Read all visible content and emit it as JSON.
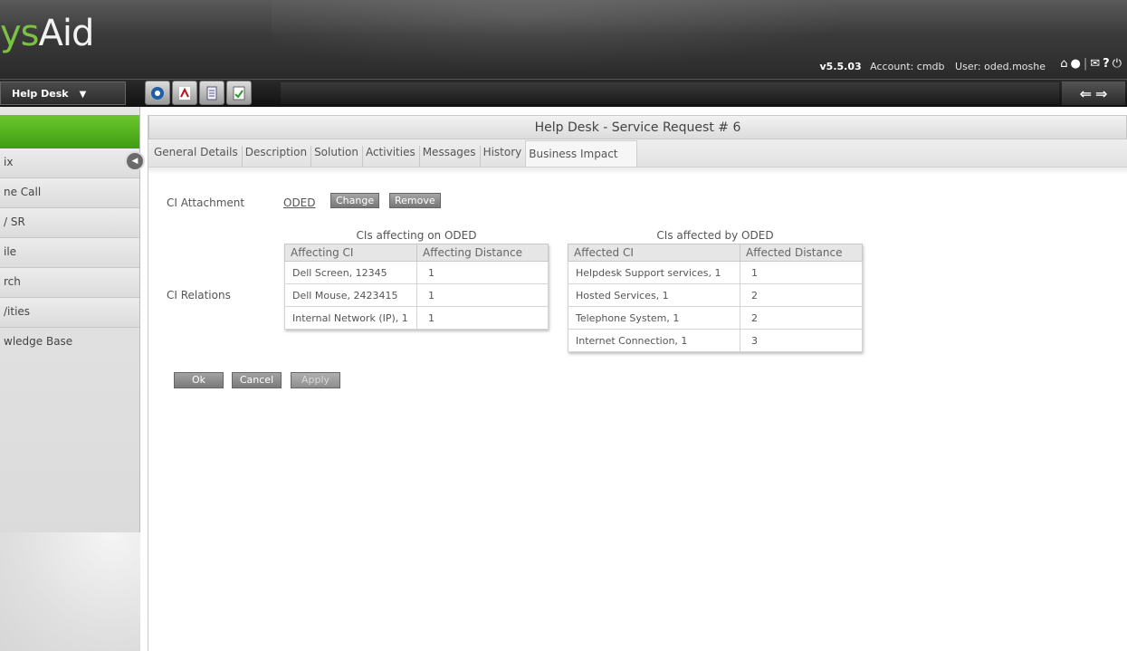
{
  "header": {
    "logo_prefix": "ys",
    "logo_suffix": "Aid",
    "version": "v5.5.03",
    "account_text": "Account: cmdb",
    "user_text": "User: oded.moshe",
    "icons": [
      "home-icon",
      "user-icon",
      "mail-icon",
      "help-icon",
      "power-icon"
    ]
  },
  "toolbar": {
    "module_label": "Help Desk",
    "tools": [
      "settings-icon",
      "pdf-icon",
      "print-icon",
      "spellcheck-icon"
    ],
    "nav": [
      "back-arrow-icon",
      "forward-arrow-icon"
    ]
  },
  "sidebar": {
    "items": [
      {
        "label": "ix"
      },
      {
        "label": "ne Call"
      },
      {
        "label": "/ SR"
      },
      {
        "label": "ile"
      },
      {
        "label": "rch"
      },
      {
        "label": "/ities"
      },
      {
        "label": "wledge Base"
      }
    ]
  },
  "main": {
    "title": "Help Desk - Service Request # 6",
    "tabs": [
      {
        "label": "General Details"
      },
      {
        "label": "Description"
      },
      {
        "label": "Solution"
      },
      {
        "label": "Activities"
      },
      {
        "label": "Messages"
      },
      {
        "label": "History"
      },
      {
        "label": "Business Impact",
        "active": true
      }
    ],
    "ci_attachment_label": "CI Attachment",
    "ci_attachment_value": "ODED",
    "change_label": "Change",
    "remove_label": "Remove",
    "ci_relations_label": "CI Relations",
    "affecting": {
      "caption": "CIs affecting on ODED",
      "columns": [
        "Affecting CI",
        "Affecting Distance"
      ],
      "rows": [
        [
          "Dell Screen, 12345",
          "1"
        ],
        [
          "Dell Mouse, 2423415",
          "1"
        ],
        [
          "Internal Network (IP), 1",
          "1"
        ]
      ]
    },
    "affected": {
      "caption": "CIs affected by ODED",
      "columns": [
        "Affected CI",
        "Affected Distance"
      ],
      "rows": [
        [
          "Helpdesk Support services, 1",
          "1"
        ],
        [
          "Hosted Services, 1",
          "2"
        ],
        [
          "Telephone System, 1",
          "2"
        ],
        [
          "Internet Connection, 1",
          "3"
        ]
      ]
    },
    "buttons": {
      "ok": "Ok",
      "cancel": "Cancel",
      "apply": "Apply"
    }
  }
}
